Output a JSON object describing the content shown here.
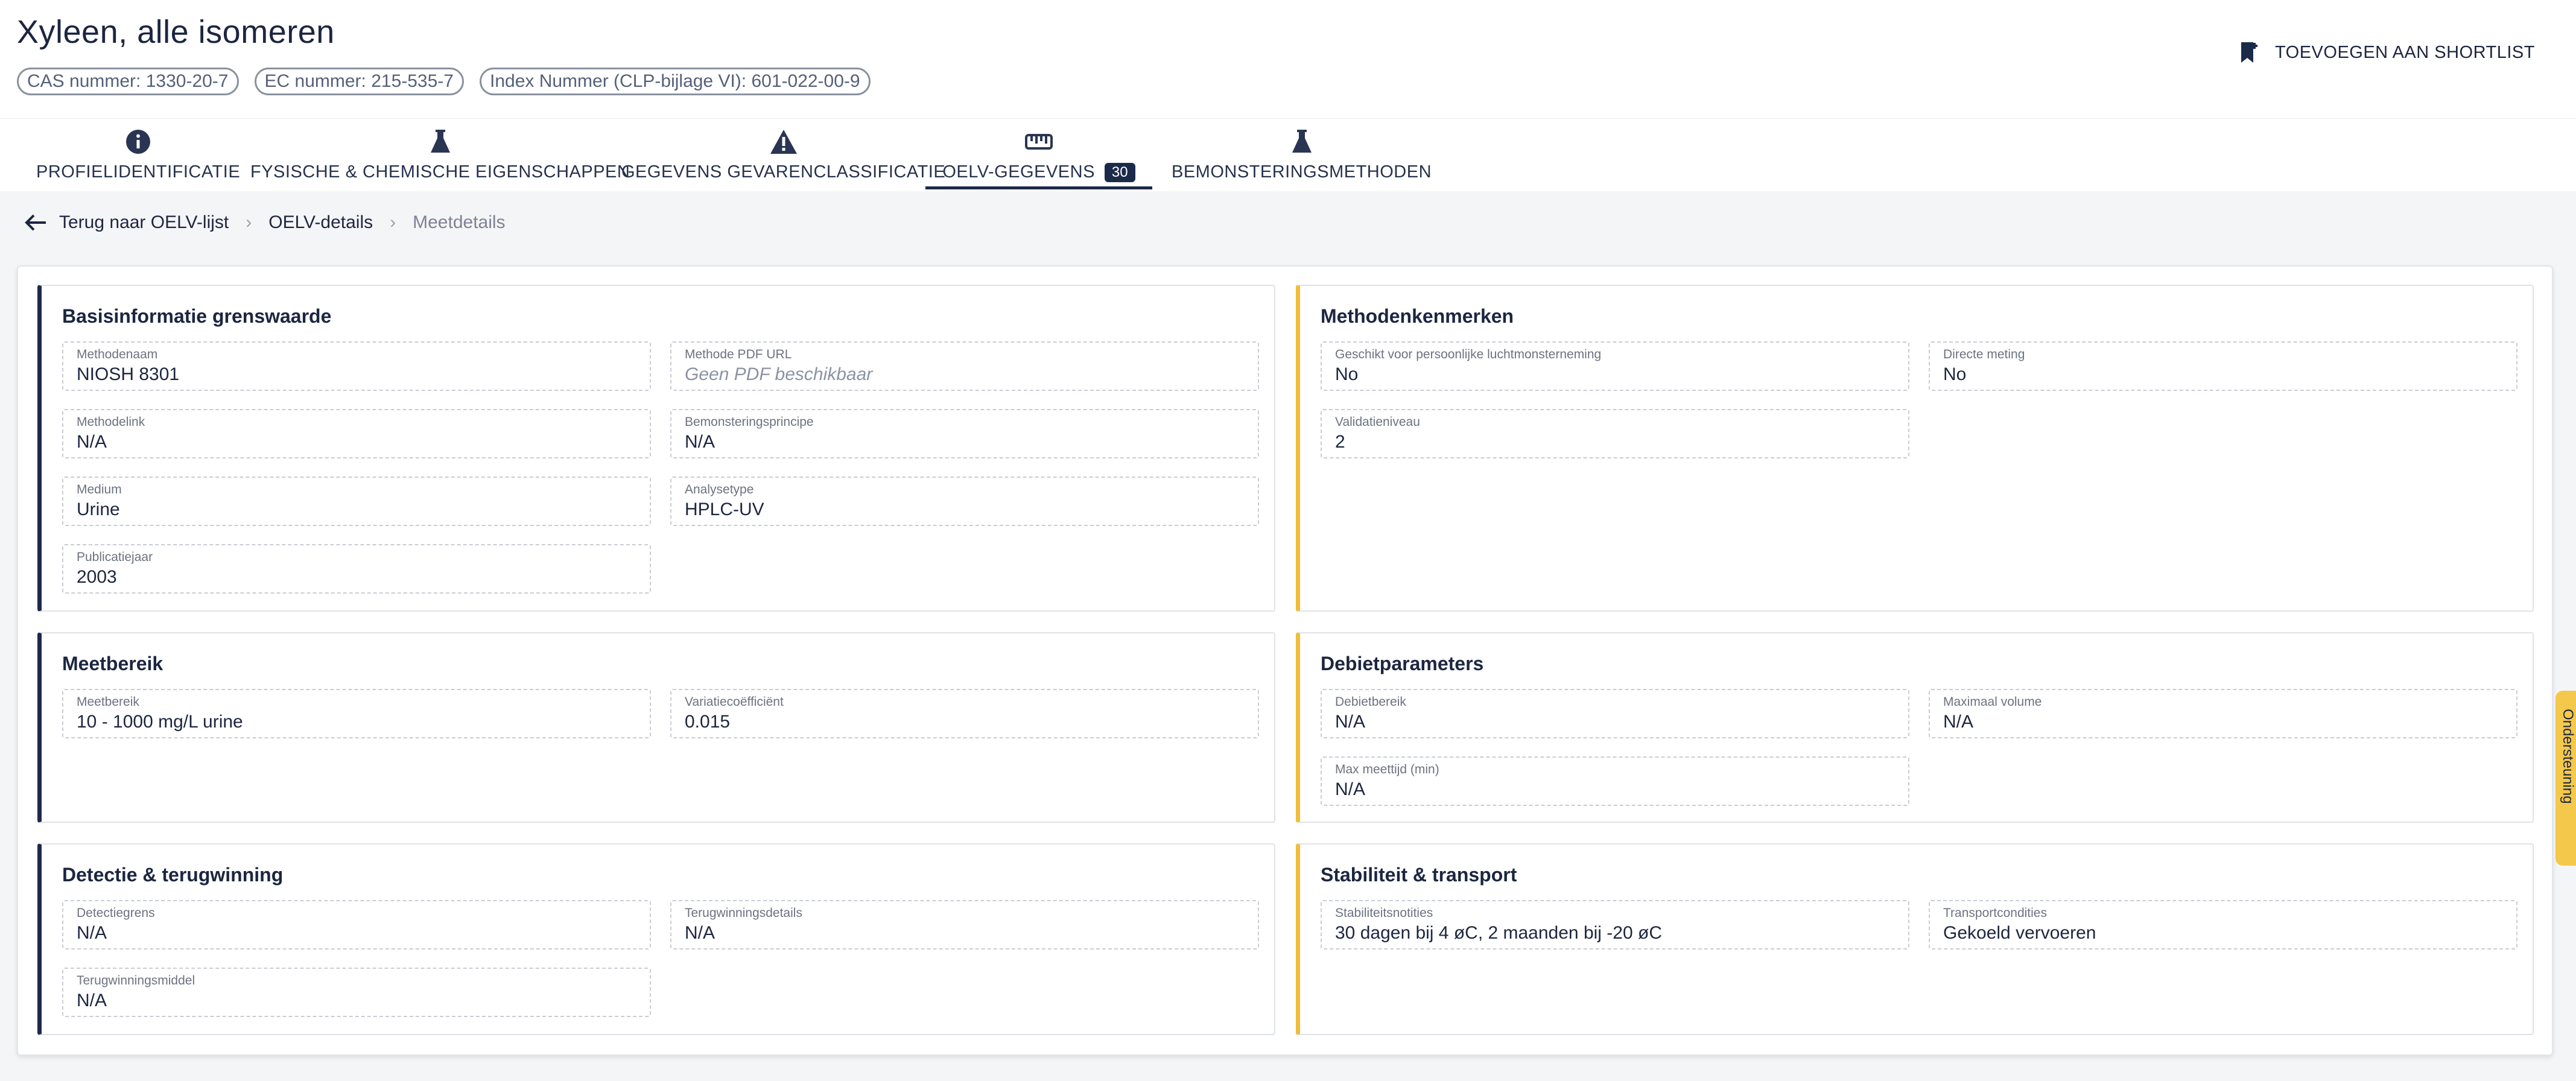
{
  "header": {
    "title": "Xyleen, alle isomeren",
    "chips": [
      "CAS nummer: 1330-20-7",
      "EC nummer: 215-535-7",
      "Index Nummer (CLP-bijlage VI): 601-022-00-9"
    ],
    "shortlist_label": "TOEVOEGEN AAN SHORTLIST"
  },
  "tabs": [
    {
      "label": "PROFIELIDENTIFICATIE",
      "icon": "info-icon"
    },
    {
      "label": "FYSISCHE & CHEMISCHE EIGENSCHAPPEN",
      "icon": "flask-icon"
    },
    {
      "label": "GEGEVENS GEVARENCLASSIFICATIE",
      "icon": "warning-icon"
    },
    {
      "label": "OELV-GEGEVENS",
      "icon": "ruler-icon",
      "badge": "30",
      "active": true
    },
    {
      "label": "BEMONSTERINGSMETHODEN",
      "icon": "flask-icon"
    }
  ],
  "breadcrumb": {
    "back": "Terug naar OELV-lijst",
    "middle": "OELV-details",
    "current": "Meetdetails"
  },
  "sections": {
    "basis": {
      "title": "Basisinformatie grenswaarde",
      "fields": [
        {
          "label": "Methodenaam",
          "value": "NIOSH 8301"
        },
        {
          "label": "Methode PDF URL",
          "value": "Geen PDF beschikbaar"
        },
        {
          "label": "Methodelink",
          "value": "N/A"
        },
        {
          "label": "Bemonsteringsprincipe",
          "value": "N/A"
        },
        {
          "label": "Medium",
          "value": "Urine"
        },
        {
          "label": "Analysetype",
          "value": "HPLC-UV"
        },
        {
          "label": "Publicatiejaar",
          "value": "2003"
        }
      ]
    },
    "methoden": {
      "title": "Methodenkenmerken",
      "fields": [
        {
          "label": "Geschikt voor persoonlijke luchtmonsterneming",
          "value": "No"
        },
        {
          "label": "Directe meting",
          "value": "No"
        },
        {
          "label": "Validatieniveau",
          "value": "2"
        }
      ]
    },
    "meetbereik": {
      "title": "Meetbereik",
      "fields": [
        {
          "label": "Meetbereik",
          "value": "10 - 1000 mg/L urine"
        },
        {
          "label": "Variatiecoëfficiënt",
          "value": "0.015"
        }
      ]
    },
    "debiet": {
      "title": "Debietparameters",
      "fields": [
        {
          "label": "Debietbereik",
          "value": "N/A"
        },
        {
          "label": "Maximaal volume",
          "value": "N/A"
        },
        {
          "label": "Max meettijd (min)",
          "value": "N/A"
        }
      ]
    },
    "detectie": {
      "title": "Detectie & terugwinning",
      "fields": [
        {
          "label": "Detectiegrens",
          "value": "N/A"
        },
        {
          "label": "Terugwinningsdetails",
          "value": "N/A"
        },
        {
          "label": "Terugwinningsmiddel",
          "value": "N/A"
        }
      ]
    },
    "stabiliteit": {
      "title": "Stabiliteit & transport",
      "fields": [
        {
          "label": "Stabiliteitsnotities",
          "value": "30 dagen bij 4 øC, 2 maanden bij -20 øC"
        },
        {
          "label": "Transportcondities",
          "value": "Gekoeld vervoeren"
        }
      ]
    }
  },
  "support_tab": {
    "label": "Ondersteuning",
    "icon": "support-icon"
  },
  "colors": {
    "navy": "#1c2a4a",
    "accent_yellow": "#f0bd3c"
  }
}
